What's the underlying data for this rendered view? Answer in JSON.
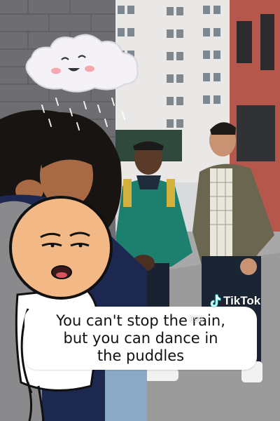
{
  "caption": {
    "text": "You can't stop the rain,\nbut you can dance in\nthe puddles"
  },
  "watermark": {
    "brand": "TikTok",
    "handle": "393",
    "icon": "tiktok-note-icon",
    "color": "#ffffff"
  },
  "stickers": {
    "cloud": "happy-rain-cloud",
    "character": "smug-face-cartoon"
  },
  "colors": {
    "brick": "#6e6e72",
    "building_right": "#b5574a",
    "jacket_green": "#1d7f6d",
    "jacket_olive": "#6a6650",
    "caption_bg": "#ffffff"
  }
}
